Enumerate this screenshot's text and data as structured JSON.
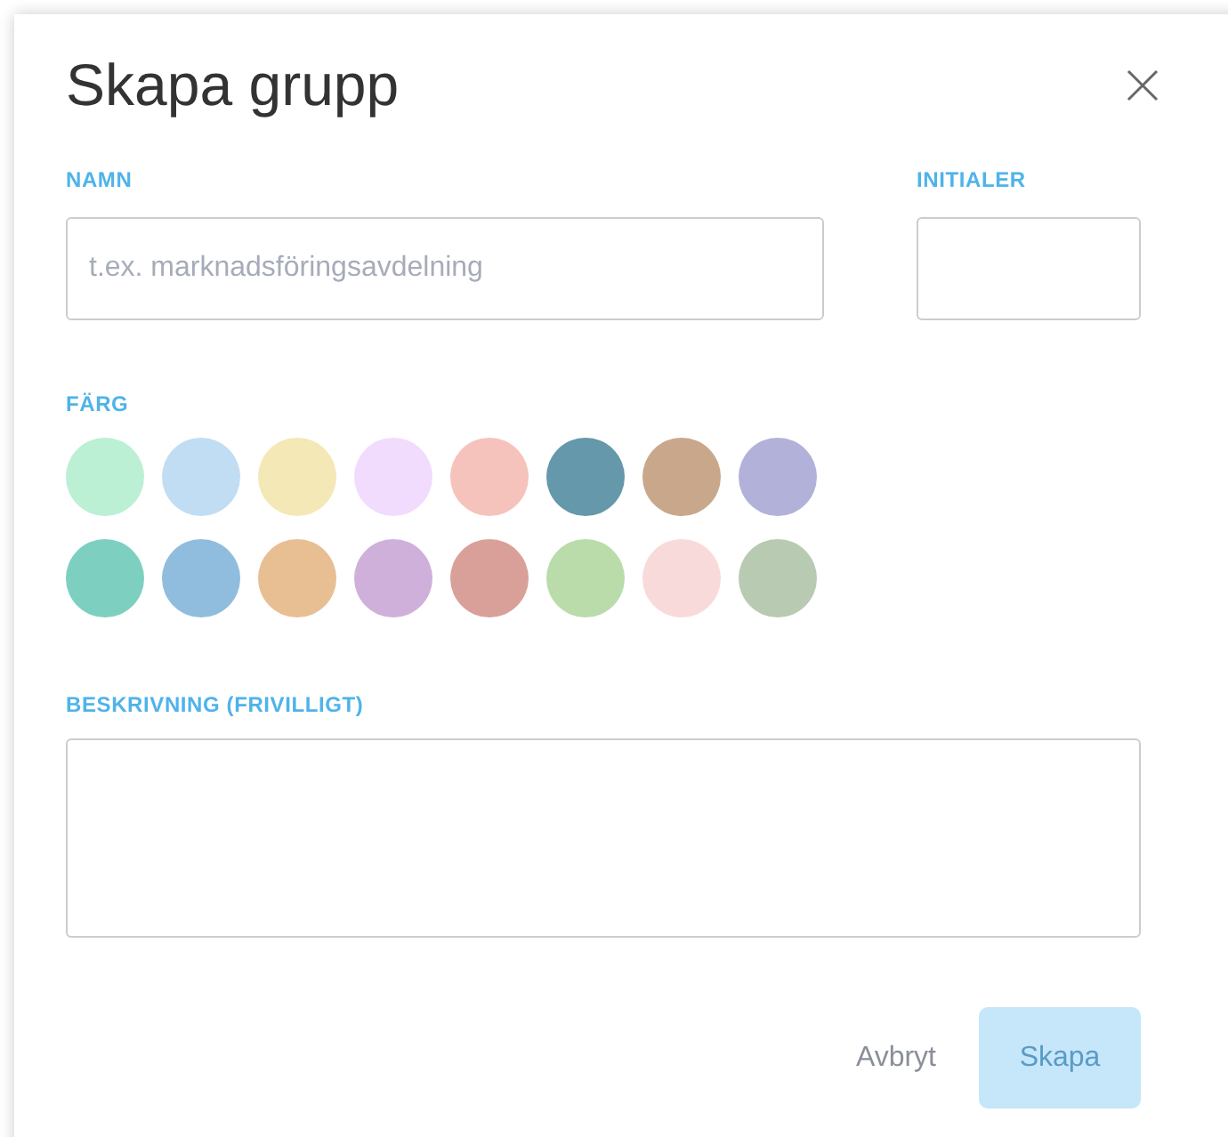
{
  "dialog": {
    "title": "Skapa grupp",
    "name_field": {
      "label": "NAMN",
      "placeholder": "t.ex. marknadsföringsavdelning"
    },
    "initials_field": {
      "label": "INITIALER"
    },
    "color_label": "FÄRG",
    "colors": [
      {
        "color": "#bbf0d5",
        "selected": false
      },
      {
        "color": "#c1ddf3",
        "selected": false
      },
      {
        "color": "#f4e8b6",
        "selected": false
      },
      {
        "color": "#f1dcfd",
        "selected": false
      },
      {
        "color": "#f5c3bc",
        "selected": false
      },
      {
        "color": "#6598aa",
        "selected": false
      },
      {
        "color": "#c9a78b",
        "selected": false
      },
      {
        "color": "#b1b1d9",
        "selected": false
      },
      {
        "color": "#7dd0c0",
        "selected": false
      },
      {
        "color": "#90bddd",
        "selected": false
      },
      {
        "color": "#e8be93",
        "selected": false
      },
      {
        "color": "#cfb0da",
        "selected": false
      },
      {
        "color": "#d9a09a",
        "selected": false
      },
      {
        "color": "#b9dcaa",
        "selected": false
      },
      {
        "color": "#f9dada",
        "selected": false
      },
      {
        "color": "#b8cab1",
        "selected": false
      }
    ],
    "description_field": {
      "label": "BESKRIVNING (FRIVILLIGT)"
    },
    "buttons": [
      {
        "label": "Avbryt",
        "kind": "cancel",
        "disabled": false
      },
      {
        "label": "Skapa",
        "kind": "primary",
        "disabled": true
      }
    ]
  }
}
